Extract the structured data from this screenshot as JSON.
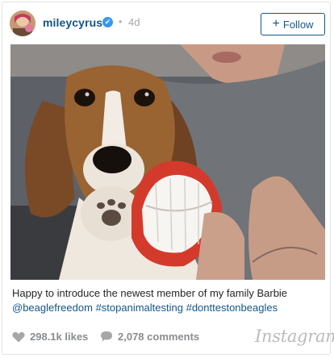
{
  "post": {
    "username": "mileycyrus",
    "verified_mark": "✔",
    "separator": "•",
    "time_ago": "4d",
    "follow_label": "Follow",
    "follow_plus": "+",
    "avatar": "user-avatar",
    "photo": "beagle-puppy-with-toy-teeth"
  },
  "caption": {
    "text": "Happy to introduce the newest member of my family Barbie",
    "tag1": "@beaglefreedom",
    "tag2": "#stopanimaltesting",
    "tag3": "#donttestonbeagles"
  },
  "stats": {
    "likes": "298.1k likes",
    "comments": "2,078 comments"
  },
  "brand": {
    "name": "Instagram"
  },
  "colors": {
    "username": "#125688",
    "verified": "#3897f0",
    "muted": "#a5a7aa"
  }
}
